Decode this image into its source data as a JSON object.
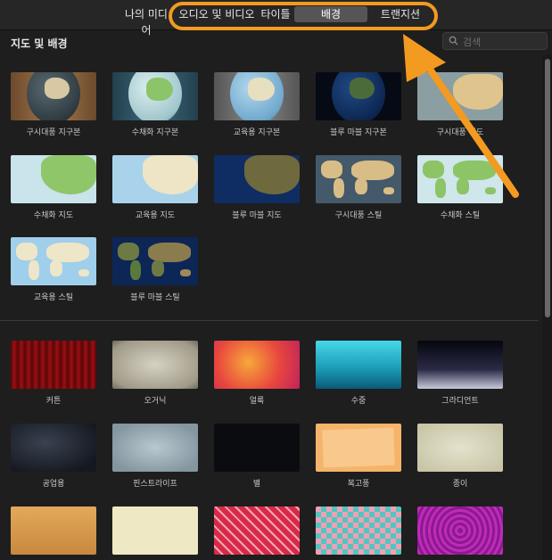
{
  "tabs": [
    {
      "label": "나의 미디어",
      "active": false
    },
    {
      "label": "오디오 및 비디오",
      "active": false
    },
    {
      "label": "타이틀",
      "active": false
    },
    {
      "label": "배경",
      "active": true
    },
    {
      "label": "트랜지션",
      "active": false
    }
  ],
  "section": {
    "title": "지도 및 배경"
  },
  "search": {
    "placeholder": "검색"
  },
  "maps": [
    {
      "label": "구시대풍 지구본"
    },
    {
      "label": "수채화 지구본"
    },
    {
      "label": "교육용 지구본"
    },
    {
      "label": "블루 마블 지구본"
    },
    {
      "label": "구시대풍 지도"
    },
    {
      "label": "수채화 지도"
    },
    {
      "label": "교육용 지도"
    },
    {
      "label": "블루 마블 지도"
    },
    {
      "label": "구시대풍 스틸"
    },
    {
      "label": "수채화 스틸"
    },
    {
      "label": "교육용 스틸"
    },
    {
      "label": "블루 마블 스틸"
    }
  ],
  "backgrounds": [
    {
      "label": "커튼"
    },
    {
      "label": "오거닉"
    },
    {
      "label": "얼룩"
    },
    {
      "label": "수중"
    },
    {
      "label": "그라디언트"
    },
    {
      "label": "공업용"
    },
    {
      "label": "핀스트라이프"
    },
    {
      "label": "별"
    },
    {
      "label": "복고풍"
    },
    {
      "label": "종이"
    }
  ],
  "colors": {
    "highlight": "#f39a21",
    "background": "#1e1e1e"
  }
}
